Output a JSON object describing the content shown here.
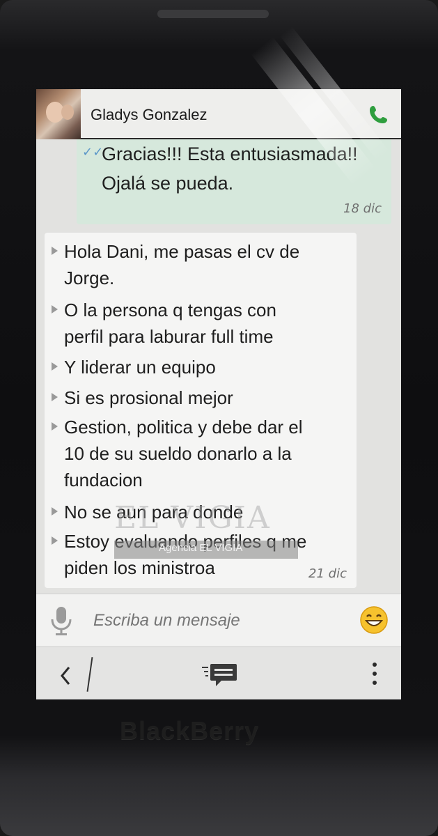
{
  "header": {
    "contact_name": "Gladys Gonzalez",
    "call_icon": "phone-icon",
    "accent_color": "#2e9e3e"
  },
  "messages": [
    {
      "direction": "outgoing",
      "status_icon": "double-check-icon",
      "text_lines": [
        "Gracias!!! Esta entusiasmada!!",
        "Ojalá se pueda."
      ],
      "time": "18 dic"
    },
    {
      "direction": "incoming",
      "items": [
        [
          "Hola Dani, me pasas el cv de",
          "Jorge."
        ],
        [
          "O la persona q tengas con",
          "perfil para laburar full time"
        ],
        [
          "Y liderar un equipo"
        ],
        [
          "Si es prosional mejor"
        ],
        [
          "Gestion, politica y debe dar el",
          "10 de su sueldo donarlo a la",
          "fundacion"
        ],
        [
          "No se aun para donde"
        ],
        [
          "Estoy evaluando perfiles q me",
          "piden los ministroa"
        ]
      ],
      "time": "21 dic"
    }
  ],
  "watermark": {
    "large": "EL VIGIA",
    "small": "Agencia EL VIGIA"
  },
  "compose": {
    "placeholder": "Escriba un mensaje",
    "mic_icon": "microphone-icon",
    "emoji_icon": "emoji-icon"
  },
  "actionbar": {
    "back_icon": "back-chevron-icon",
    "center_icon": "chat-icon",
    "more_icon": "more-vertical-icon"
  },
  "device": {
    "brand": "BlackBerry"
  }
}
